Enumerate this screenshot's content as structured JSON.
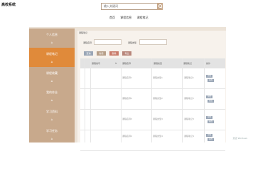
{
  "app": {
    "brand": "高校系统"
  },
  "search": {
    "placeholder": "输入关键词"
  },
  "topnav": {
    "items": [
      "首页",
      "课程信息",
      "课程笔记"
    ]
  },
  "sidebar": {
    "items": [
      {
        "label": "个人信息",
        "icon": "person-icon"
      },
      {
        "label": "课程笔记",
        "icon": "note-icon",
        "active": true
      },
      {
        "label": "课程收藏",
        "icon": "bookmark-icon"
      },
      {
        "label": "我的作业",
        "icon": "assignment-icon"
      },
      {
        "label": "学习资料",
        "icon": "folder-icon"
      },
      {
        "label": "学习任务",
        "icon": "task-icon"
      }
    ]
  },
  "breadcrumb": "课程笔记",
  "filters": {
    "field1_label": "课程名称",
    "field2_label": "课程类型"
  },
  "buttons": {
    "search": "查询",
    "add": "新增",
    "delete": "删除",
    "export": "导出"
  },
  "table": {
    "headers": [
      "",
      "",
      "课程编号",
      "课程名称",
      "课程类型",
      "课程笔记",
      "操作"
    ],
    "rows": [
      {
        "c1": "课程名称1",
        "c2": "课程名称1",
        "c3": "课程类型1",
        "c4": "课程笔记1"
      },
      {
        "c1": "课程名称2",
        "c2": "课程名称2",
        "c3": "课程类型2",
        "c4": "课程笔记2"
      },
      {
        "c1": "课程名称3",
        "c2": "课程名称3",
        "c3": "课程类型3",
        "c4": "课程笔记3"
      },
      {
        "c1": "课程名称4",
        "c2": "课程名称4",
        "c3": "课程类型4",
        "c4": "课程笔记4"
      }
    ],
    "row_actions": {
      "detail": "详情",
      "edit": "修改"
    }
  },
  "watermark": "激活 Windows",
  "colors": {
    "accent": "#e08a3a",
    "sidebar": "#c8a98c",
    "button_add": "#b79f88",
    "button_delete": "#c97b6a"
  }
}
